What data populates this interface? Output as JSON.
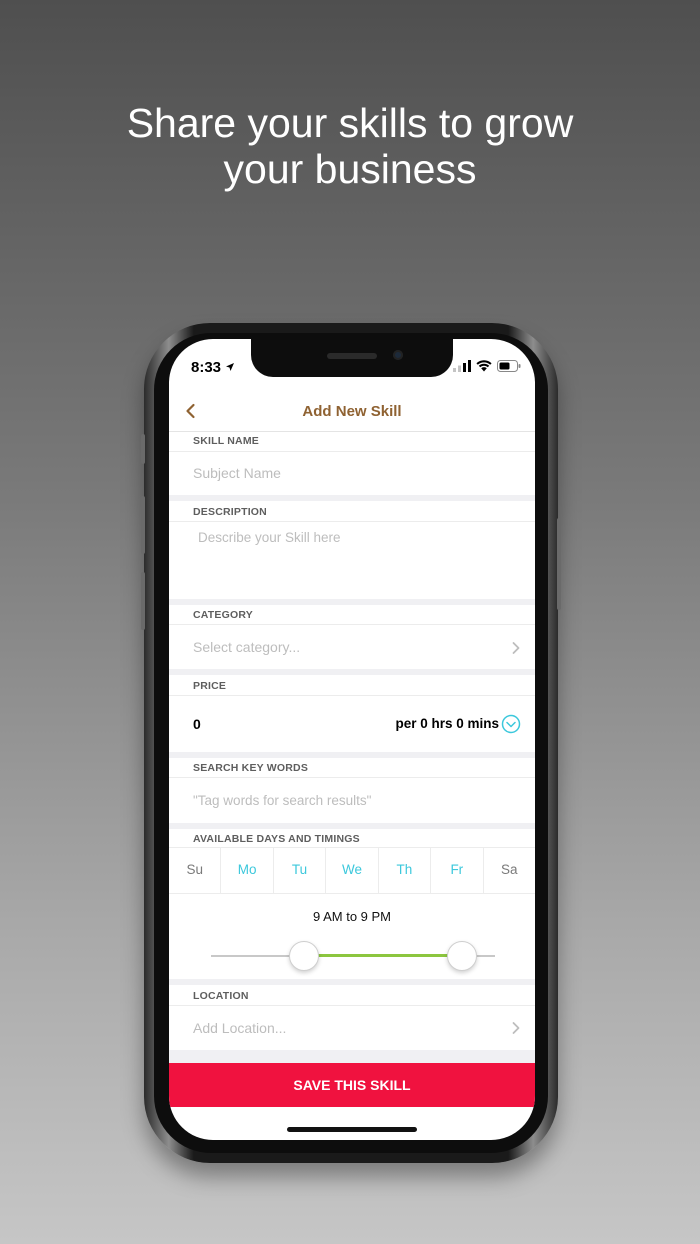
{
  "headline": {
    "line1": "Share your skills to grow",
    "line2": "your business"
  },
  "status_bar": {
    "time": "8:33"
  },
  "nav": {
    "title": "Add New Skill"
  },
  "form": {
    "skill_name": {
      "label": "SKILL NAME",
      "placeholder": "Subject Name"
    },
    "description": {
      "label": "DESCRIPTION",
      "placeholder": "Describe your Skill here"
    },
    "category": {
      "label": "CATEGORY",
      "placeholder": "Select category..."
    },
    "price": {
      "label": "PRICE",
      "value": "0",
      "duration": "per 0 hrs 0 mins"
    },
    "search_keywords": {
      "label": "SEARCH KEY WORDS",
      "placeholder": "\"Tag words for search results\""
    },
    "availability": {
      "label": "AVAILABLE DAYS AND TIMINGS",
      "days": [
        {
          "label": "Su",
          "selected": false
        },
        {
          "label": "Mo",
          "selected": true
        },
        {
          "label": "Tu",
          "selected": true
        },
        {
          "label": "We",
          "selected": true
        },
        {
          "label": "Th",
          "selected": true
        },
        {
          "label": "Fr",
          "selected": true
        },
        {
          "label": "Sa",
          "selected": false
        }
      ],
      "time_range": "9 AM to 9 PM"
    },
    "location": {
      "label": "LOCATION",
      "placeholder": "Add Location..."
    }
  },
  "save_button": {
    "label": "SAVE THIS SKILL"
  },
  "colors": {
    "accent_title": "#8f6232",
    "day_active": "#3cc8dc",
    "slider_fill": "#8cc63f",
    "save_button": "#f0123f"
  }
}
